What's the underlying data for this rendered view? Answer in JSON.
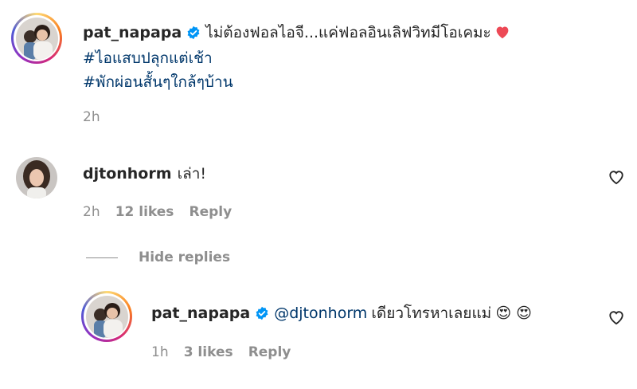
{
  "post": {
    "username": "pat_napapa",
    "caption": "ไม่ต้องฟอลไอจี...แค่ฟอลอินเลิฟวิทมีโอเคมะ",
    "caption_emoji": "❤️",
    "hashtags": [
      "#ไอแสบปลุกแต่เช้า",
      "#พักผ่อนสั้นๆใกล้ๆบ้าน"
    ],
    "time": "2h"
  },
  "comment": {
    "username": "djtonhorm",
    "text": "เล่า!",
    "time": "2h",
    "likes": "12 likes",
    "reply_label": "Reply"
  },
  "hide_replies": "Hide replies",
  "reply": {
    "username": "pat_napapa",
    "mention": "@djtonhorm",
    "text": "เดียวโทรหาเลยแม่",
    "emojis": "😍 😍",
    "time": "1h",
    "likes": "3 likes",
    "reply_label": "Reply"
  },
  "colors": {
    "link": "#00376b",
    "verified": "#0095f6",
    "heart_red": "#ed4956",
    "meta": "#8e8e8e"
  },
  "icons": {
    "verified": "verified-badge-icon",
    "like": "heart-outline-icon"
  }
}
